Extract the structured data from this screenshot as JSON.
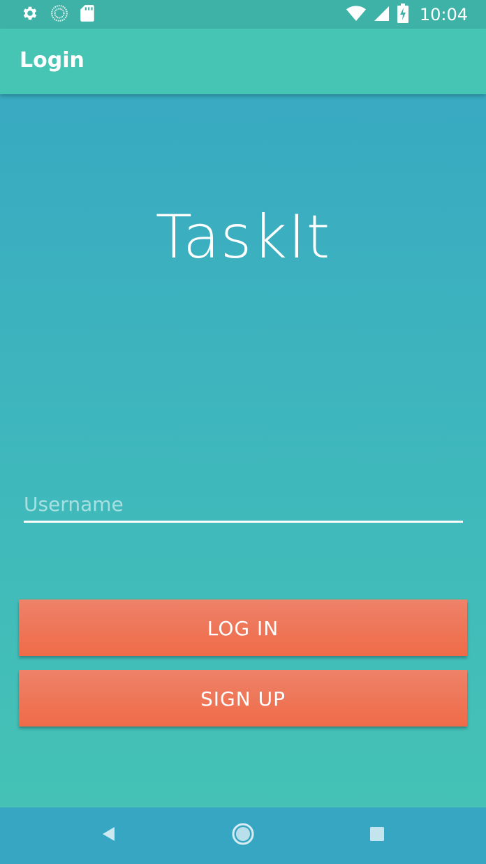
{
  "status_bar": {
    "time": "10:04",
    "left_icons": [
      "settings-icon",
      "sync-icon",
      "sd-card-icon"
    ],
    "right_icons": [
      "wifi-icon",
      "cell-signal-icon",
      "battery-charging-icon"
    ]
  },
  "app_bar": {
    "title": "Login"
  },
  "brand": {
    "name": "TaskIt"
  },
  "form": {
    "username_placeholder": "Username",
    "username_value": ""
  },
  "buttons": {
    "login_label": "LOG IN",
    "signup_label": "SIGN UP"
  },
  "nav_bar": {
    "icons": [
      "back-icon",
      "home-icon",
      "recents-icon"
    ]
  },
  "colors": {
    "status_bar": "#3eb2a7",
    "app_bar": "#47c5b4",
    "background_top": "#37a6c3",
    "background_bottom": "#46c4b4",
    "button": "#ef6b48",
    "nav_bar": "#37a6c3"
  }
}
